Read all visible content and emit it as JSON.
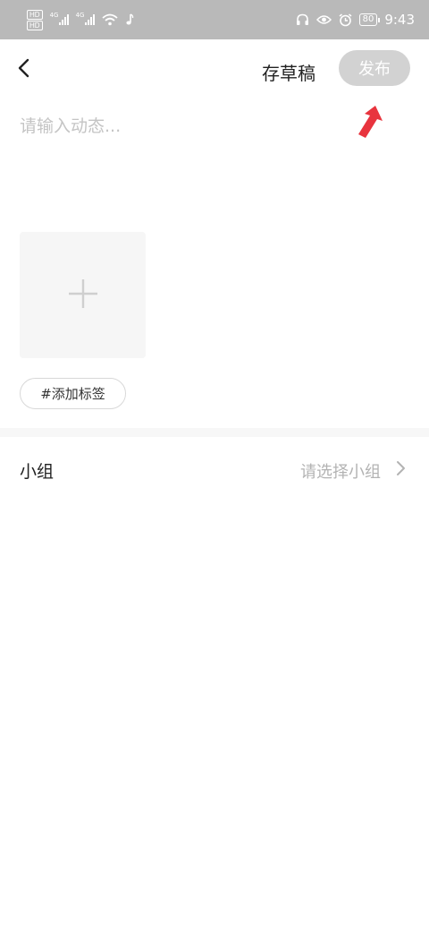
{
  "status_bar": {
    "hd_1": "HD",
    "hd_2": "HD",
    "net_1": "4G",
    "net_2": "4G",
    "battery": "80",
    "time": "9:43"
  },
  "header": {
    "draft_label": "存草稿",
    "publish_label": "发布"
  },
  "editor": {
    "placeholder": "请输入动态..."
  },
  "tags": {
    "add_tag_label": "#添加标签"
  },
  "group": {
    "label": "小组",
    "value": "请选择小组"
  },
  "colors": {
    "status_bar_bg": "#b9b9b9",
    "publish_button_bg": "#d2d2d2",
    "annotation_arrow": "#e8343e",
    "placeholder_text": "#c4c4c4"
  },
  "icons": {
    "back": "back-icon",
    "add": "plus-icon",
    "chevron": "chevron-right-icon",
    "annotation": "red-arrow-annotation"
  }
}
